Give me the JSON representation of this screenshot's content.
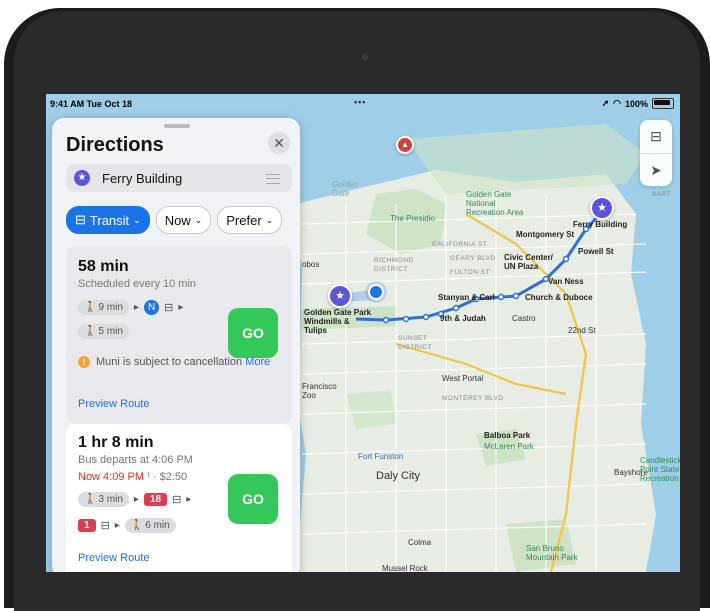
{
  "status_bar": {
    "time": "9:41 AM  Tue Oct 18",
    "dots": "•••",
    "battery": "100%"
  },
  "panel": {
    "title": "Directions",
    "close_icon": "✕",
    "destination": "Ferry Building",
    "filters": {
      "transit": "Transit",
      "now": "Now",
      "prefer": "Prefer"
    },
    "routes": [
      {
        "duration": "58 min",
        "schedule": "Scheduled every 10 min",
        "walk1": "9 min",
        "walk2": "5 min",
        "go": "GO",
        "notice": "Muni is subject to cancellation",
        "notice_more": "More",
        "preview": "Preview Route"
      },
      {
        "duration": "1 hr 8 min",
        "departs": "Bus departs at 4:06 PM",
        "now_time": "Now 4:09 PM",
        "price": "· $2.50",
        "walk1": "3 min",
        "bus1": "18",
        "bus2": "1",
        "walk2": "6 min",
        "go": "GO",
        "preview": "Preview Route"
      }
    ]
  },
  "map": {
    "labels": {
      "golden_gate_water": "Golden\nGate",
      "ggnra": "Golden Gate\nNational\nRecreation Area",
      "presidio": "The Presidio",
      "california": "CALIFORNIA ST",
      "richmond": "RICHMOND\nDISTRICT",
      "geary": "GEARY BLVD",
      "fulton": "FULTON ST",
      "montgomery": "Montgomery St",
      "ferry_building": "Ferry Building",
      "powell": "Powell St",
      "civic_center": "Civic Center/\nUN Plaza",
      "van_ness": "Van Ness",
      "church": "Church & Duboce",
      "stanyan": "Stanyan & Carl",
      "judah": "9th & Judah",
      "castro": "Castro",
      "st22": "22nd St",
      "gg_park": "Golden Gate Park\nWindmills &\nTulips",
      "sunset": "SUNSET\nDISTRICT",
      "west_portal": "West Portal",
      "monterey": "MONTEREY BLVD",
      "francisco_zoo": "Francisco\nZoo",
      "balboa": "Balboa Park",
      "mclaren": "McLaren Park",
      "fort_funston": "Fort Funston",
      "daly_city": "Daly City",
      "bayshore": "Bayshore",
      "candlestick": "Candlestick\nPoint State\nRecreation",
      "colma": "Colma",
      "san_bruno": "San Bruno\nMountain Park",
      "mussel": "Mussel Rock",
      "bart": "BART",
      "obos": "obos"
    }
  },
  "colors": {
    "accent": "#1a73e8",
    "go": "#34c759",
    "alert": "#e8301e",
    "destination_pin": "#5a56d6",
    "route_line": "#2f6fd1"
  }
}
